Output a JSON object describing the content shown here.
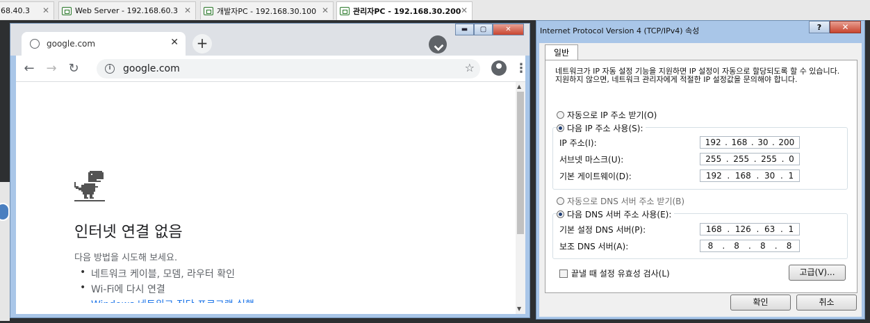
{
  "vm_tabs": [
    {
      "label": "68.40.3",
      "active": false
    },
    {
      "label": "Web Server - 192.168.60.3",
      "active": false
    },
    {
      "label": "개발자PC - 192.168.30.100",
      "active": false
    },
    {
      "label": "관리자PC - 192.168.30.200",
      "active": true
    }
  ],
  "chrome": {
    "tab_title": "google.com",
    "tab_close": "✕",
    "new_tab": "+",
    "url": "google.com",
    "back": "←",
    "forward": "→",
    "reload": "↻",
    "star": "☆",
    "menu": "⋮",
    "win_minimize": "▬",
    "win_maximize": "▢",
    "win_close": "✕"
  },
  "error_page": {
    "title": "인터넷 연결 없음",
    "subtitle": "다음 방법을 시도해 보세요.",
    "items": [
      "네트워크 케이블, 모뎀, 라우터 확인",
      "Wi-Fi에 다시 연결"
    ],
    "partial_link": "Windows 네트워크 진단 프로그램 실행"
  },
  "dialog": {
    "title": "Internet Protocol Version 4 (TCP/IPv4) 속성",
    "help": "?",
    "close": "✕",
    "tab": "일반",
    "description": "네트워크가 IP 자동 설정 기능을 지원하면 IP 설정이 자동으로 할당되도록 할 수 있습니다. 지원하지 않으면, 네트워크 관리자에게 적절한 IP 설정값을 문의해야 합니다.",
    "auto_ip": "자동으로 IP 주소 받기(O)",
    "manual_ip": "다음 IP 주소 사용(S):",
    "ip_label": "IP 주소(I):",
    "ip": [
      "192",
      "168",
      "30",
      "200"
    ],
    "subnet_label": "서브넷 마스크(U):",
    "subnet": [
      "255",
      "255",
      "255",
      "0"
    ],
    "gateway_label": "기본 게이트웨이(D):",
    "gateway": [
      "192",
      "168",
      "30",
      "1"
    ],
    "auto_dns": "자동으로 DNS 서버 주소 받기(B)",
    "manual_dns": "다음 DNS 서버 주소 사용(E):",
    "dns1_label": "기본 설정 DNS 서버(P):",
    "dns1": [
      "168",
      "126",
      "63",
      "1"
    ],
    "dns2_label": "보조 DNS 서버(A):",
    "dns2": [
      "8",
      "8",
      "8",
      "8"
    ],
    "validate_label": "끝낼 때 설정 유효성 검사(L)",
    "advanced": "고급(V)...",
    "ok": "확인",
    "cancel": "취소"
  }
}
